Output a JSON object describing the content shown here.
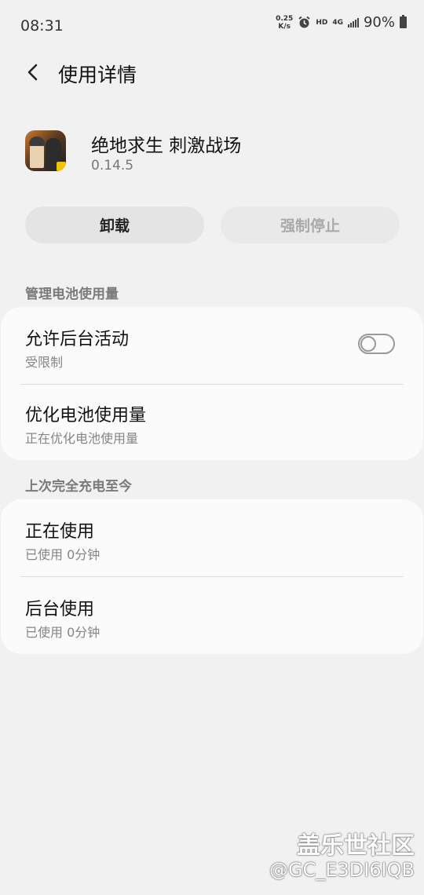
{
  "status_bar": {
    "time": "08:31",
    "net_speed_value": "0.25",
    "net_speed_unit": "K/s",
    "hd": "HD",
    "network": "4G",
    "battery": "90%",
    "icons": [
      "alarm-icon",
      "signal-icon",
      "battery-icon"
    ]
  },
  "header": {
    "title": "使用详情",
    "back_icon": "chevron-left-icon"
  },
  "app": {
    "name": "绝地求生 刺激战场",
    "version": "0.14.5"
  },
  "buttons": {
    "uninstall": "卸载",
    "force_stop": "强制停止"
  },
  "battery_section": {
    "label": "管理电池使用量",
    "items": [
      {
        "title": "允许后台活动",
        "subtitle": "受限制",
        "toggle_on": false
      },
      {
        "title": "优化电池使用量",
        "subtitle": "正在优化电池使用量"
      }
    ]
  },
  "usage_section": {
    "label": "上次完全充电至今",
    "items": [
      {
        "title": "正在使用",
        "subtitle": "已使用 0分钟"
      },
      {
        "title": "后台使用",
        "subtitle": "已使用 0分钟"
      }
    ]
  },
  "watermark": {
    "brand": "盖乐世社区",
    "user": "@GC_E3DI6IQB"
  }
}
